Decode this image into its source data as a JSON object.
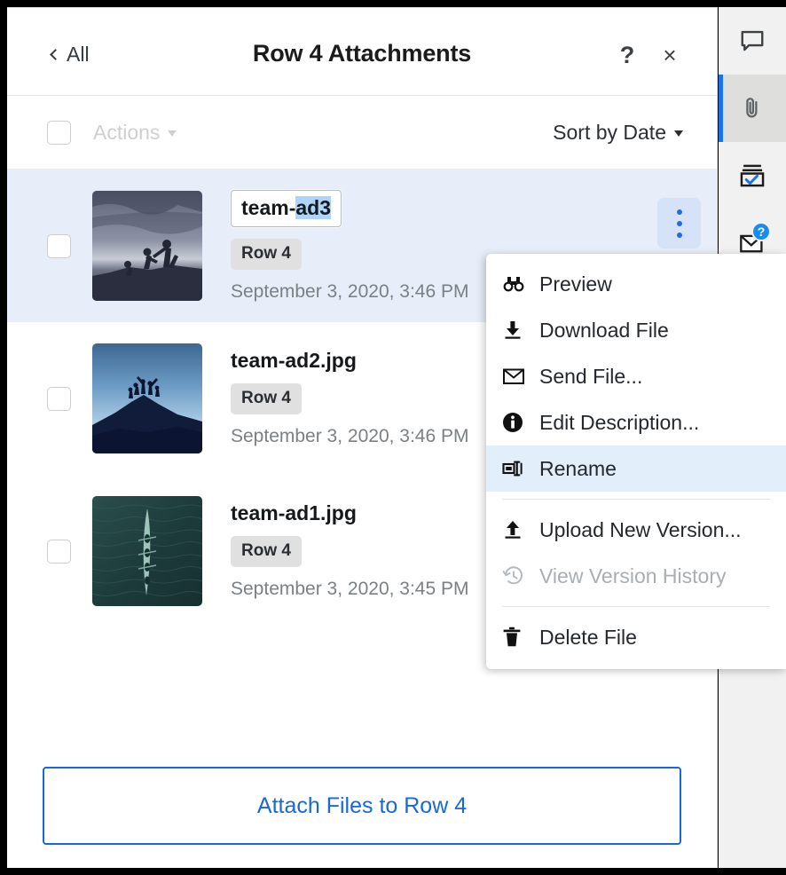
{
  "header": {
    "back_label": "All",
    "title": "Row 4 Attachments",
    "help_glyph": "?",
    "close_glyph": "×"
  },
  "toolbar": {
    "actions_label": "Actions",
    "sort_label": "Sort by Date"
  },
  "files": [
    {
      "name": "team-ad3",
      "rename_prefix": "team-",
      "rename_selected": "ad3",
      "badge": "Row 4",
      "date": "September 3, 2020, 3:46 PM",
      "editing": true,
      "selected": true,
      "thumb": "hikers-sunset-silhouette"
    },
    {
      "name": "team-ad2.jpg",
      "badge": "Row 4",
      "date": "September 3, 2020, 3:46 PM",
      "editing": false,
      "selected": false,
      "thumb": "mountain-summit-silhouette"
    },
    {
      "name": "team-ad1.jpg",
      "badge": "Row 4",
      "date": "September 3, 2020, 3:45 PM",
      "editing": false,
      "selected": false,
      "thumb": "rowing-boat-aerial"
    }
  ],
  "attach_button": {
    "label": "Attach Files to Row 4"
  },
  "context_menu": {
    "items": [
      {
        "label": "Preview",
        "icon": "binoculars-icon",
        "state": "normal"
      },
      {
        "label": "Download File",
        "icon": "download-icon",
        "state": "normal"
      },
      {
        "label": "Send File...",
        "icon": "envelope-icon",
        "state": "normal"
      },
      {
        "label": "Edit Description...",
        "icon": "info-icon",
        "state": "normal"
      },
      {
        "label": "Rename",
        "icon": "rename-icon",
        "state": "highlight"
      },
      {
        "label": "Upload New Version...",
        "icon": "upload-icon",
        "state": "normal"
      },
      {
        "label": "View Version History",
        "icon": "history-icon",
        "state": "disabled"
      },
      {
        "label": "Delete File",
        "icon": "trash-icon",
        "state": "normal"
      }
    ]
  },
  "rail": {
    "items": [
      {
        "icon": "comment-icon",
        "active": false,
        "badge": ""
      },
      {
        "icon": "paperclip-icon",
        "active": true,
        "badge": ""
      },
      {
        "icon": "proof-icon",
        "active": false,
        "badge": ""
      },
      {
        "icon": "envelope-icon",
        "active": false,
        "badge": "?"
      }
    ]
  },
  "colors": {
    "accent_blue": "#1668dc",
    "rail_active_bar": "#1a73e8",
    "row_selected_bg": "#e7edf9",
    "menu_highlight_bg": "#e3eefb",
    "badge_blue": "#1a8cf0",
    "text_selection_blue": "#aed4fb"
  }
}
